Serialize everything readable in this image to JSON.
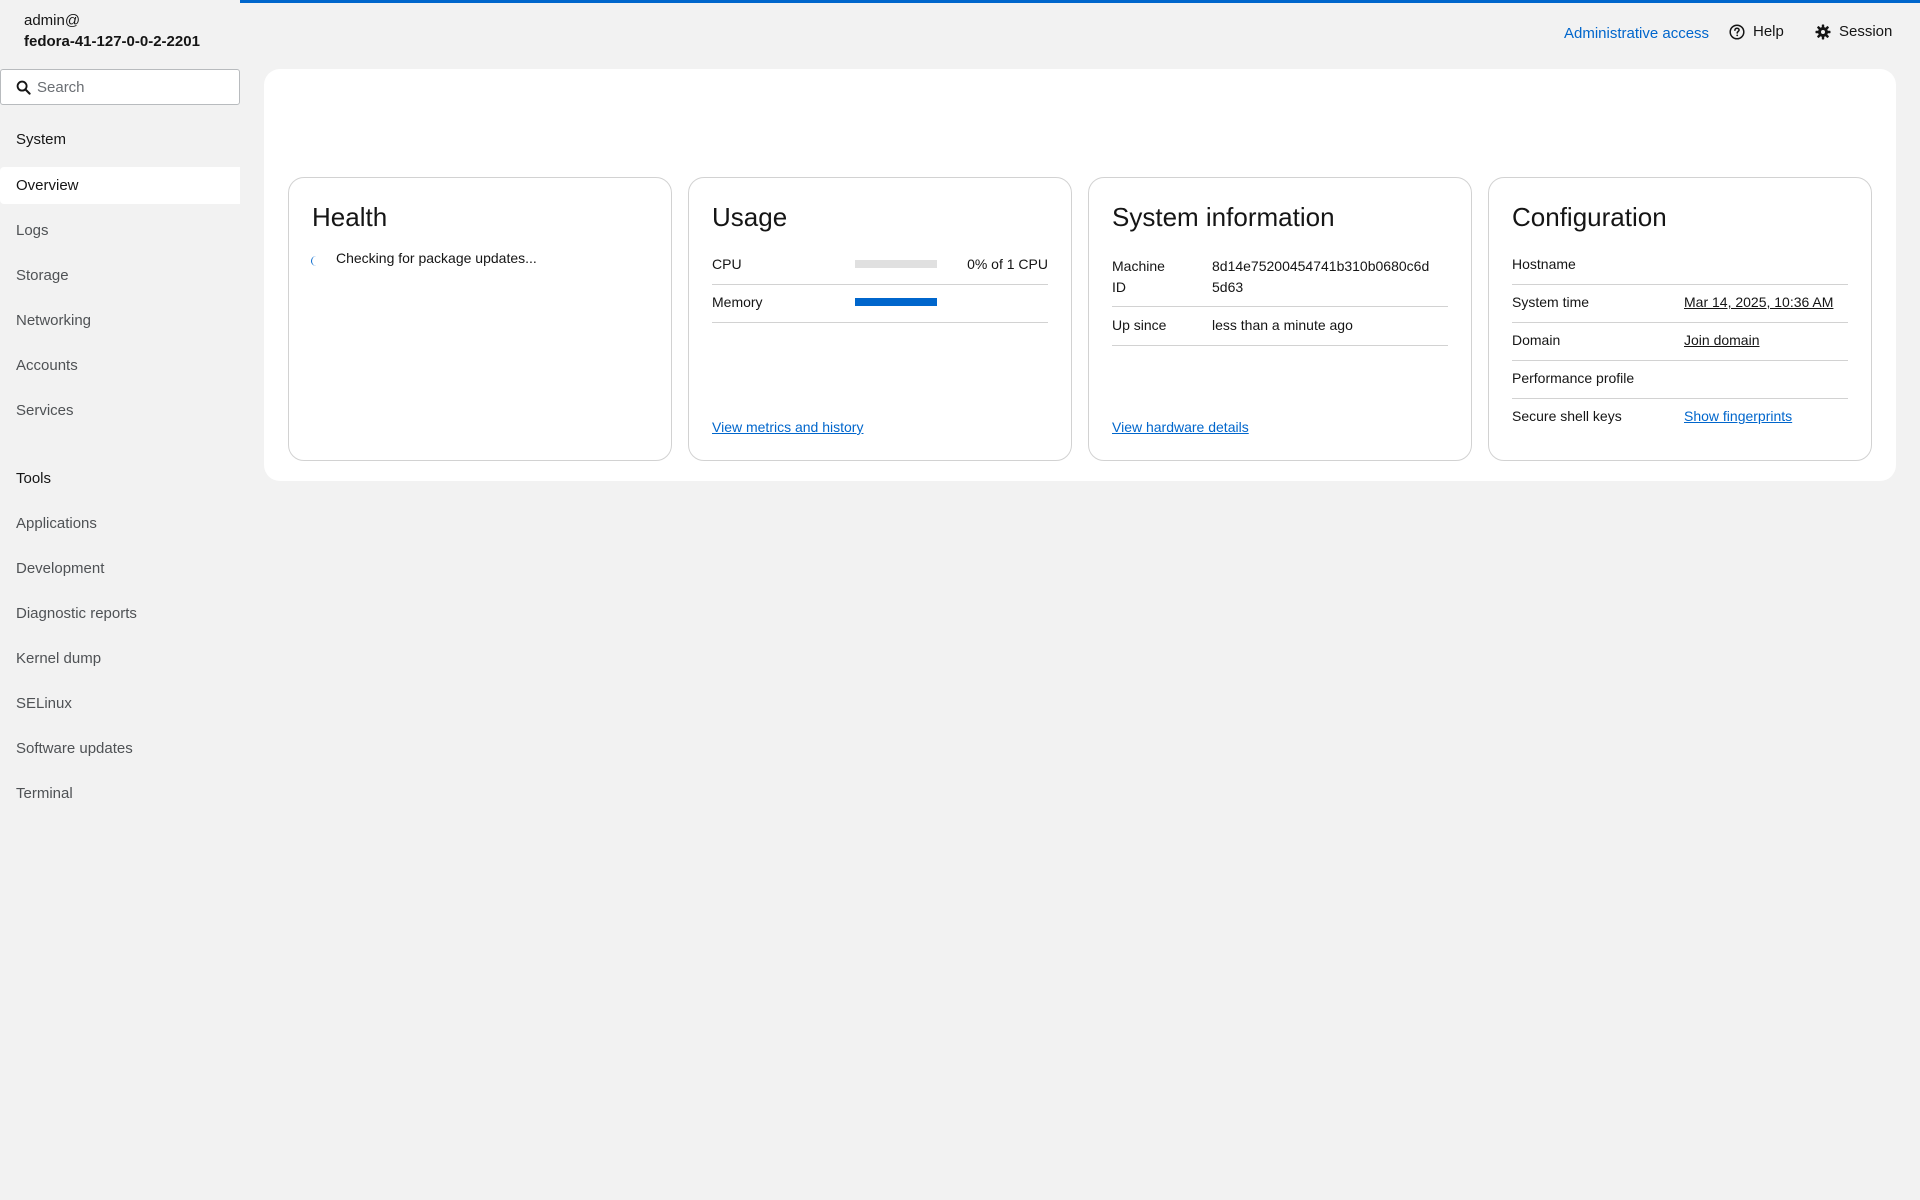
{
  "host": {
    "user": "admin@",
    "name": "fedora-41-127-0-0-2-2201"
  },
  "search": {
    "placeholder": "Search"
  },
  "nav": {
    "system_heading": "System",
    "system_items": [
      "Overview",
      "Logs",
      "Storage",
      "Networking",
      "Accounts",
      "Services"
    ],
    "tools_heading": "Tools",
    "tools_items": [
      "Applications",
      "Development",
      "Diagnostic reports",
      "Kernel dump",
      "SELinux",
      "Software updates",
      "Terminal"
    ],
    "active": "Overview"
  },
  "topbar": {
    "admin_access": "Administrative access",
    "help": "Help",
    "session": "Session"
  },
  "health": {
    "title": "Health",
    "status": "Checking for package updates..."
  },
  "usage": {
    "title": "Usage",
    "cpu_label": "CPU",
    "cpu_value": "0% of 1 CPU",
    "cpu_fraction": 0.0,
    "memory_label": "Memory",
    "memory_fraction": 1.0,
    "link": "View metrics and history"
  },
  "sysinfo": {
    "title": "System information",
    "machine_id_label_1": "Machine",
    "machine_id_label_2": "ID",
    "machine_id_line_1": "8d14e75200454741b310b0680c6d",
    "machine_id_line_2": "5d63",
    "up_since_label": "Up since",
    "up_since_value": "less than a minute ago",
    "link": "View hardware details"
  },
  "config": {
    "title": "Configuration",
    "hostname_label": "Hostname",
    "time_label": "System time",
    "time_value": "Mar 14, 2025, 10:36 AM",
    "domain_label": "Domain",
    "domain_value": "Join domain",
    "perf_label": "Performance profile",
    "ssh_label": "Secure shell keys",
    "ssh_value": "Show fingerprints"
  },
  "colors": {
    "accent": "#0066cc",
    "background": "#f2f2f2",
    "border": "#d2d2d2"
  }
}
